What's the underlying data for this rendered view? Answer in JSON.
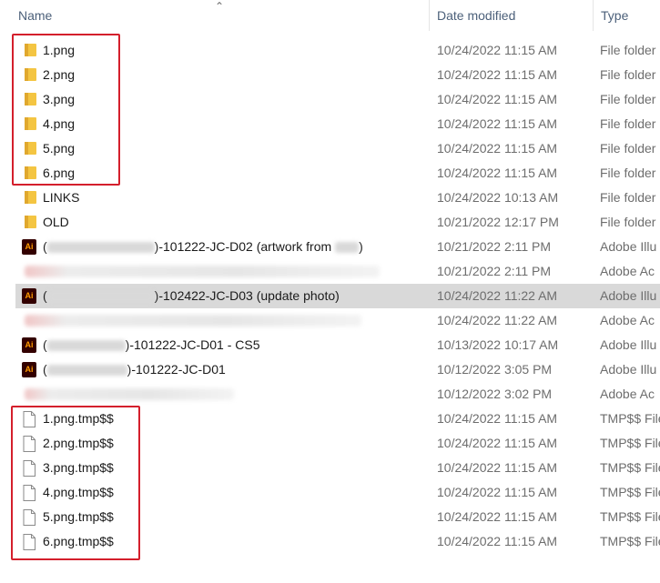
{
  "columns": {
    "name": "Name",
    "date_modified": "Date modified",
    "type": "Type"
  },
  "files": [
    {
      "icon": "folder-icon",
      "name": "1.png",
      "date": "10/24/2022 11:15 AM",
      "type": "File folder"
    },
    {
      "icon": "folder-icon",
      "name": "2.png",
      "date": "10/24/2022 11:15 AM",
      "type": "File folder"
    },
    {
      "icon": "folder-icon",
      "name": "3.png",
      "date": "10/24/2022 11:15 AM",
      "type": "File folder"
    },
    {
      "icon": "folder-icon",
      "name": "4.png",
      "date": "10/24/2022 11:15 AM",
      "type": "File folder"
    },
    {
      "icon": "folder-icon",
      "name": "5.png",
      "date": "10/24/2022 11:15 AM",
      "type": "File folder"
    },
    {
      "icon": "folder-icon",
      "name": "6.png",
      "date": "10/24/2022 11:15 AM",
      "type": "File folder"
    },
    {
      "icon": "folder-icon",
      "name": "LINKS",
      "date": "10/24/2022 10:13 AM",
      "type": "File folder"
    },
    {
      "icon": "folder-icon",
      "name": "OLD",
      "date": "10/21/2022 12:17 PM",
      "type": "File folder"
    },
    {
      "icon": "illustrator-icon",
      "name_prefix": "(",
      "name_suffix": ")-101222-JC-D02 (artwork from",
      "name_end": ")",
      "date": "10/21/2022 2:11 PM",
      "type": "Adobe Illu"
    },
    {
      "icon": "blurred-icon",
      "name": "",
      "date": "10/21/2022 2:11 PM",
      "type": "Adobe Ac"
    },
    {
      "icon": "illustrator-icon",
      "name_prefix": "(",
      "name_suffix": ")-102422-JC-D03 (update photo)",
      "date": "10/24/2022 11:22 AM",
      "type": "Adobe Illu",
      "selected": true
    },
    {
      "icon": "blurred-icon",
      "name": "",
      "date": "10/24/2022 11:22 AM",
      "type": "Adobe Ac"
    },
    {
      "icon": "illustrator-icon",
      "name_prefix": "(",
      "name_suffix": ")-101222-JC-D01 - CS5",
      "date": "10/13/2022 10:17 AM",
      "type": "Adobe Illu"
    },
    {
      "icon": "illustrator-icon",
      "name_prefix": "(",
      "name_suffix": ")-101222-JC-D01",
      "date": "10/12/2022 3:05 PM",
      "type": "Adobe Illu"
    },
    {
      "icon": "blurred-icon",
      "name": "",
      "date": "10/12/2022 3:02 PM",
      "type": "Adobe Ac"
    },
    {
      "icon": "file-icon",
      "name": "1.png.tmp$$",
      "date": "10/24/2022 11:15 AM",
      "type": "TMP$$ File"
    },
    {
      "icon": "file-icon",
      "name": "2.png.tmp$$",
      "date": "10/24/2022 11:15 AM",
      "type": "TMP$$ File"
    },
    {
      "icon": "file-icon",
      "name": "3.png.tmp$$",
      "date": "10/24/2022 11:15 AM",
      "type": "TMP$$ File"
    },
    {
      "icon": "file-icon",
      "name": "4.png.tmp$$",
      "date": "10/24/2022 11:15 AM",
      "type": "TMP$$ File"
    },
    {
      "icon": "file-icon",
      "name": "5.png.tmp$$",
      "date": "10/24/2022 11:15 AM",
      "type": "TMP$$ File"
    },
    {
      "icon": "file-icon",
      "name": "6.png.tmp$$",
      "date": "10/24/2022 11:15 AM",
      "type": "TMP$$ File"
    }
  ],
  "colors": {
    "highlight_box": "#d41f2c",
    "selected_row": "#d9d9d9",
    "folder": "#f4c542"
  }
}
